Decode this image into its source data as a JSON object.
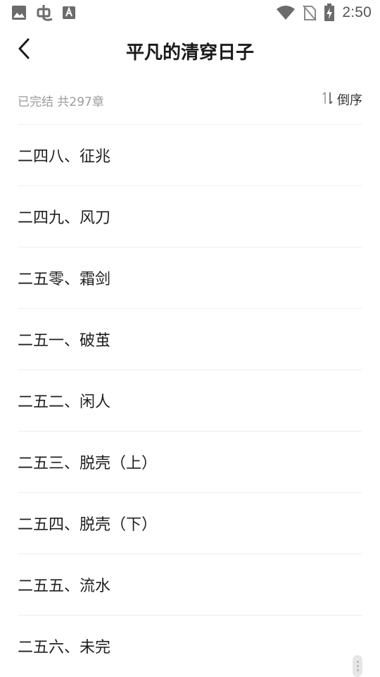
{
  "status_bar": {
    "time": "2:50",
    "icons": [
      "image-icon",
      "bug-icon",
      "keyboard-icon",
      "wifi-icon",
      "no-sim-icon",
      "battery-charging-icon"
    ]
  },
  "header": {
    "title": "平凡的清穿日子",
    "back_icon": "chevron-left-icon"
  },
  "info": {
    "status_text": "已完结 共297章",
    "sort_label": "倒序",
    "sort_icon": "sort-arrows-icon"
  },
  "chapters": [
    "二四八、征兆",
    "二四九、风刀",
    "二五零、霜剑",
    "二五一、破茧",
    "二五二、闲人",
    "二五三、脱壳（上）",
    "二五四、脱壳（下）",
    "二五五、流水",
    "二五六、未完"
  ],
  "colors": {
    "background": "#ffffff",
    "text_primary": "#1f1f1f",
    "text_secondary": "#9a9a9a",
    "divider": "#eeeeee"
  }
}
